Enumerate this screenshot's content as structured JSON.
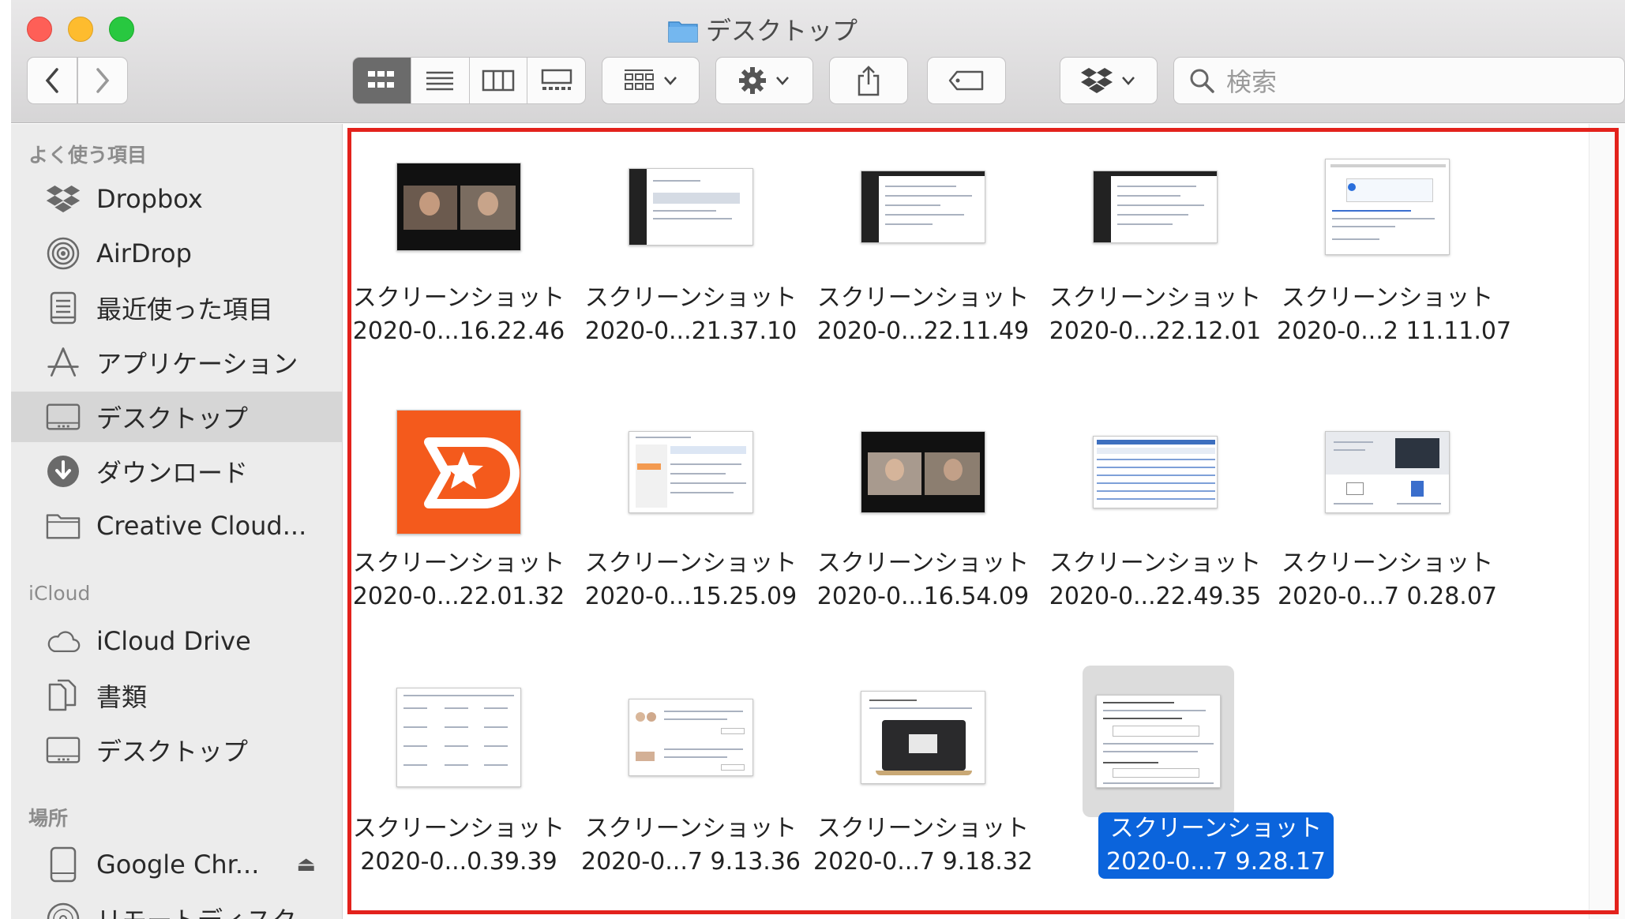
{
  "window": {
    "title": "デスクトップ"
  },
  "toolbar": {
    "back_label": "‹",
    "forward_label": "›",
    "search_placeholder": "検索"
  },
  "sidebar": {
    "favorites_header": "よく使う項目",
    "favorites": [
      {
        "label": "Dropbox",
        "icon": "dropbox-icon"
      },
      {
        "label": "AirDrop",
        "icon": "airdrop-icon"
      },
      {
        "label": "最近使った項目",
        "icon": "recents-icon"
      },
      {
        "label": "アプリケーション",
        "icon": "applications-icon"
      },
      {
        "label": "デスクトップ",
        "icon": "desktop-icon",
        "selected": true
      },
      {
        "label": "ダウンロード",
        "icon": "download-icon"
      },
      {
        "label": "Creative Cloud...",
        "icon": "folder-icon"
      }
    ],
    "icloud_header": "iCloud",
    "icloud": [
      {
        "label": "iCloud Drive",
        "icon": "cloud-icon"
      },
      {
        "label": "書類",
        "icon": "documents-icon"
      },
      {
        "label": "デスクトップ",
        "icon": "desktop-icon"
      }
    ],
    "locations_header": "場所",
    "locations": [
      {
        "label": "Google Chr...",
        "icon": "disk-icon",
        "eject": "⏏"
      },
      {
        "label": "リモートディスク",
        "icon": "remote-disk-icon"
      }
    ]
  },
  "files": [
    {
      "line1": "スクリーンショット",
      "line2": "2020-0...16.22.46"
    },
    {
      "line1": "スクリーンショット",
      "line2": "2020-0...21.37.10"
    },
    {
      "line1": "スクリーンショット",
      "line2": "2020-0...22.11.49"
    },
    {
      "line1": "スクリーンショット",
      "line2": "2020-0...22.12.01"
    },
    {
      "line1": "スクリーンショット",
      "line2": "2020-0...2 11.11.07"
    },
    {
      "line1": "スクリーンショット",
      "line2": "2020-0...22.01.32"
    },
    {
      "line1": "スクリーンショット",
      "line2": "2020-0...15.25.09"
    },
    {
      "line1": "スクリーンショット",
      "line2": "2020-0...16.54.09"
    },
    {
      "line1": "スクリーンショット",
      "line2": "2020-0...22.49.35"
    },
    {
      "line1": "スクリーンショット",
      "line2": "2020-0...7 0.28.07"
    },
    {
      "line1": "スクリーンショット",
      "line2": "2020-0...0.39.39"
    },
    {
      "line1": "スクリーンショット",
      "line2": "2020-0...7 9.13.36"
    },
    {
      "line1": "スクリーンショット",
      "line2": "2020-0...7 9.18.32"
    },
    {
      "line1": "スクリーンショット",
      "line2": "2020-0...7 9.28.17",
      "selected": true
    }
  ],
  "colors": {
    "selection": "#0b64dc",
    "highlight_border": "#e3221c",
    "traffic_close": "#fe5f57",
    "traffic_min": "#febc2e",
    "traffic_max": "#28c840"
  }
}
